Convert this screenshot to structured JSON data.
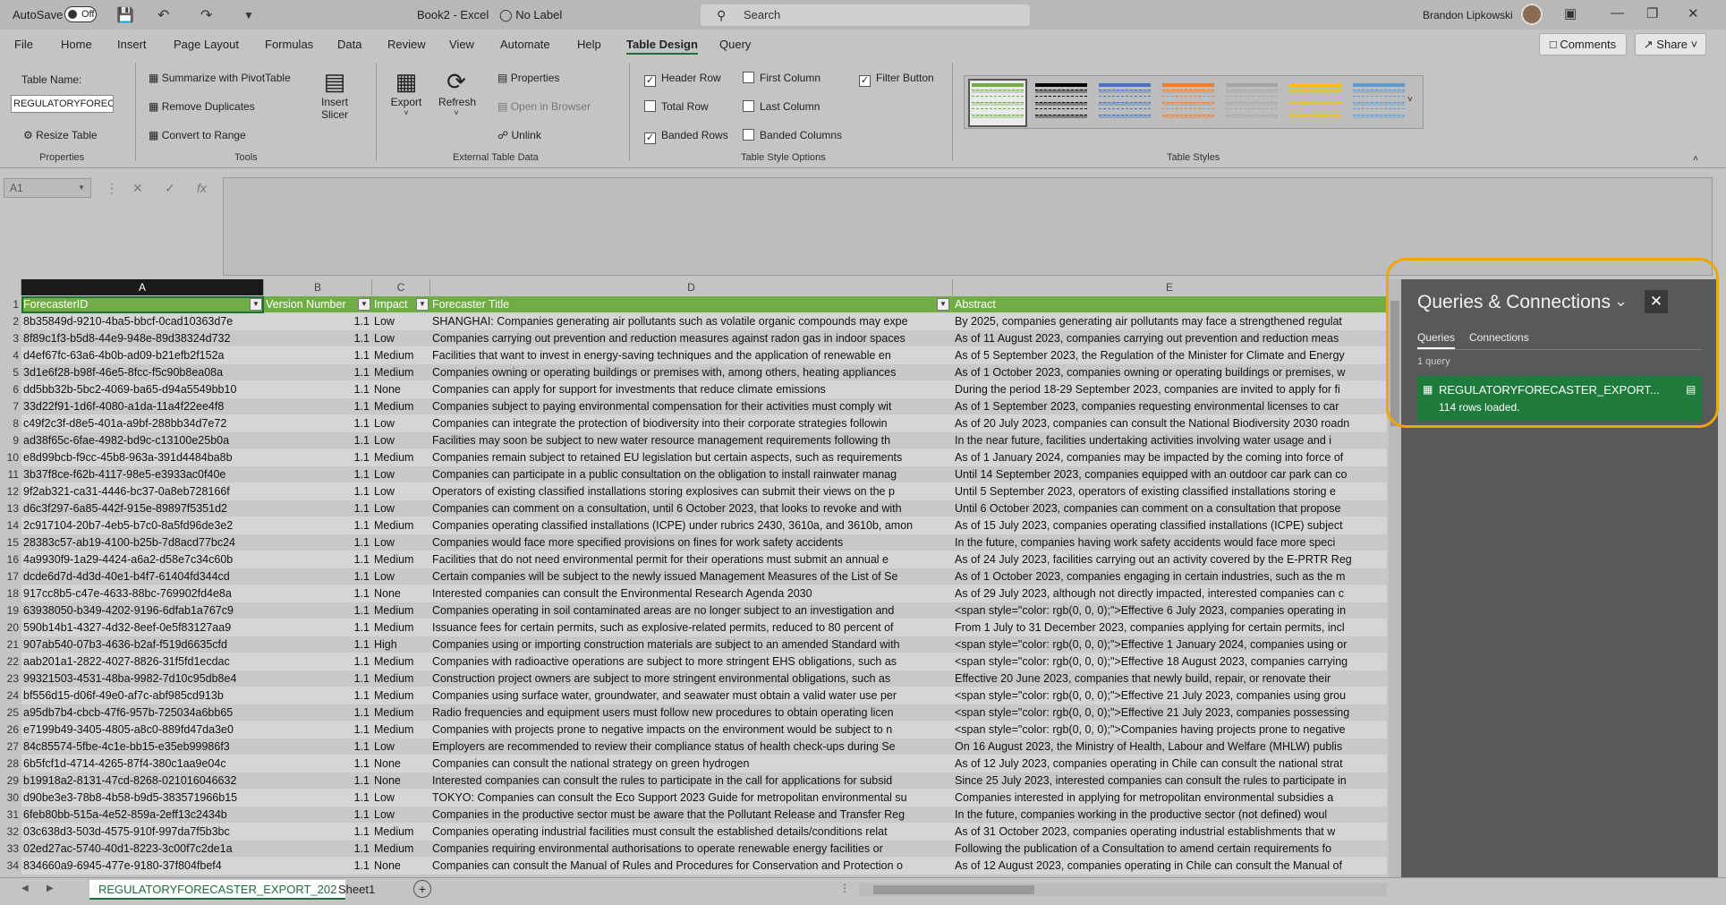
{
  "titlebar": {
    "autosave": "AutoSave",
    "toggle": "Off",
    "doc": "Book2 - Excel",
    "label": "No Label",
    "search": "Search",
    "user": "Brandon Lipkowski"
  },
  "menu": [
    "File",
    "Home",
    "Insert",
    "Page Layout",
    "Formulas",
    "Data",
    "Review",
    "View",
    "Automate",
    "Help",
    "Table Design",
    "Query"
  ],
  "menu_active": "Table Design",
  "actions": {
    "comments": "Comments",
    "share": "Share"
  },
  "ribbon": {
    "table_name_label": "Table Name:",
    "table_name": "REGULATORYFORECA",
    "resize": "Resize Table",
    "properties_group": "Properties",
    "summarize": "Summarize with PivotTable",
    "remove_dup": "Remove Duplicates",
    "convert": "Convert to Range",
    "tools_group": "Tools",
    "insert_slicer_1": "Insert",
    "insert_slicer_2": "Slicer",
    "export": "Export",
    "refresh": "Refresh",
    "properties": "Properties",
    "open_browser": "Open in Browser",
    "unlink": "Unlink",
    "external_group": "External Table Data",
    "header_row": "Header Row",
    "total_row": "Total Row",
    "banded_rows": "Banded Rows",
    "first_col": "First Column",
    "last_col": "Last Column",
    "banded_cols": "Banded Columns",
    "filter_btn": "Filter Button",
    "style_opts_group": "Table Style Options",
    "styles_group": "Table Styles",
    "checks": {
      "header_row": true,
      "total_row": false,
      "banded_rows": true,
      "first_col": false,
      "last_col": false,
      "banded_cols": false,
      "filter_btn": true
    },
    "swatch_colors": [
      "#70ad47",
      "#000000",
      "#4472c4",
      "#ed7d31",
      "#a5a5a5",
      "#ffc000",
      "#5b9bd5"
    ]
  },
  "formula": {
    "namebox": "A1"
  },
  "columns": [
    "A",
    "B",
    "C",
    "D",
    "E"
  ],
  "headers": [
    "ForecasterID",
    "Version Number",
    "Impact",
    "Forecaster Title",
    "Abstract"
  ],
  "rows": [
    [
      "8b35849d-9210-4ba5-bbcf-0cad10363d7e",
      "1.1",
      "Low",
      "SHANGHAI: Companies generating air pollutants such as volatile organic compounds may expe",
      "By 2025, companies generating air pollutants may face a strengthened regulat"
    ],
    [
      "8f89c1f3-b5d8-44e9-948e-89d38324d732",
      "1.1",
      "Low",
      "Companies carrying out prevention and reduction measures against radon gas in indoor spaces",
      "As of 11 August 2023, companies carrying out prevention and reduction meas"
    ],
    [
      "d4ef67fc-63a6-4b0b-ad09-b21efb2f152a",
      "1.1",
      "Medium",
      "Facilities that want to invest in energy-saving techniques and the application of renewable en",
      "As of 5 September 2023, the Regulation of the Minister for Climate and Energy"
    ],
    [
      "3d1e6f28-b98f-46e5-8fcc-f5c90b8ea08a",
      "1.1",
      "Medium",
      "Companies owning or operating buildings or premises with, among others, heating appliances",
      "As of 1 October 2023, companies owning or operating buildings or premises, w"
    ],
    [
      "dd5bb32b-5bc2-4069-ba65-d94a5549bb10",
      "1.1",
      "None",
      "Companies can apply for support for investments that reduce climate emissions",
      "During the period 18-29 September 2023, companies are invited to apply for fi"
    ],
    [
      "33d22f91-1d6f-4080-a1da-11a4f22ee4f8",
      "1.1",
      "Medium",
      "Companies subject to paying environmental compensation for their activities must comply wit",
      "As of 1 September 2023, companies requesting environmental licenses to car"
    ],
    [
      "c49f2c3f-d8e5-401a-a9bf-288bb34d7e72",
      "1.1",
      "Low",
      "Companies can integrate the protection of biodiversity into their corporate strategies followin",
      "As of 20 July 2023, companies can consult the National Biodiversity 2030 roadn"
    ],
    [
      "ad38f65c-6fae-4982-bd9c-c13100e25b0a",
      "1.1",
      "Low",
      "Facilities may soon be subject to new water resource management requirements following th",
      "In the near future, facilities undertaking activities involving water usage and i"
    ],
    [
      "e8d99bcb-f9cc-45b8-963a-391d4484ba8b",
      "1.1",
      "Medium",
      "Companies remain subject to retained EU legislation but certain aspects, such as requirements",
      "As of 1 January 2024, companies may be impacted by the coming into force of"
    ],
    [
      "3b37f8ce-f62b-4117-98e5-e3933ac0f40e",
      "1.1",
      "Low",
      "Companies can participate in a public consultation on the obligation to install rainwater manag",
      "Until 14 September 2023, companies equipped with an outdoor car park can co"
    ],
    [
      "9f2ab321-ca31-4446-bc37-0a8eb728166f",
      "1.1",
      "Low",
      "Operators of existing classified installations storing explosives can submit their views on the p",
      "Until 5 September 2023, operators of existing classified installations storing e"
    ],
    [
      "d6c3f297-6a85-442f-915e-89897f5351d2",
      "1.1",
      "Low",
      "Companies can comment on a consultation, until 6 October 2023, that looks to revoke and with",
      "Until 6 October 2023, companies can comment on a consultation that propose"
    ],
    [
      "2c917104-20b7-4eb5-b7c0-8a5fd96de3e2",
      "1.1",
      "Medium",
      "Companies operating classified installations (ICPE) under rubrics 2430, 3610a, and 3610b, amon",
      "As of 15 July 2023, companies operating classified installations (ICPE) subject"
    ],
    [
      "28383c57-ab19-4100-b25b-7d8acd77bc24",
      "1.1",
      "Low",
      "Companies would face more specified provisions on fines for work safety accidents",
      "In the future, companies having work safety accidents would face more speci"
    ],
    [
      "4a9930f9-1a29-4424-a6a2-d58e7c34c60b",
      "1.1",
      "Medium",
      "Facilities that do not need environmental permit for their operations must submit an annual e",
      "As of 24 July 2023, facilities carrying out an activity covered by the E-PRTR Reg"
    ],
    [
      "dcde6d7d-4d3d-40e1-b4f7-61404fd344cd",
      "1.1",
      "Low",
      "Certain companies will be subject to the newly issued Management Measures of the List of Se",
      "As of 1 October 2023, companies engaging in certain industries, such as the m"
    ],
    [
      "917cc8b5-c47e-4633-88bc-769902fd4e8a",
      "1.1",
      "None",
      "Interested companies can consult the Environmental Research Agenda 2030",
      "As of 29 July 2023, although not directly impacted, interested companies can c"
    ],
    [
      "63938050-b349-4202-9196-6dfab1a767c9",
      "1.1",
      "Medium",
      "Companies operating in soil contaminated areas are no longer subject to an investigation and",
      "<span style=\"color: rgb(0, 0, 0);\">Effective 6 July 2023, companies operating in"
    ],
    [
      "590b14b1-4327-4d32-8eef-0e5f83127aa9",
      "1.1",
      "Medium",
      "Issuance fees for certain permits, such as explosive-related permits, reduced to 80 percent of",
      "From 1 July to 31 December 2023, companies applying for certain permits, incl"
    ],
    [
      "907ab540-07b3-4636-b2af-f519d6635cfd",
      "1.1",
      "High",
      "Companies using or importing construction materials are subject to an amended Standard with",
      "<span style=\"color: rgb(0, 0, 0);\">Effective 1 January 2024, companies using or"
    ],
    [
      "aab201a1-2822-4027-8826-31f5fd1ecdac",
      "1.1",
      "Medium",
      "Companies with radioactive operations are subject to more stringent EHS obligations, such as",
      "<span style=\"color: rgb(0, 0, 0);\">Effective 18 August 2023, companies carrying"
    ],
    [
      "99321503-4531-48ba-9982-7d10c95db8e4",
      "1.1",
      "Medium",
      "Construction project owners are subject to more stringent environmental obligations, such as",
      "Effective 20 June 2023, companies that newly build, repair, or renovate their"
    ],
    [
      "bf556d15-d06f-49e0-af7c-abf985cd913b",
      "1.1",
      "Medium",
      "Companies using surface water, groundwater, and seawater must obtain a valid water use per",
      "<span style=\"color: rgb(0, 0, 0);\">Effective 21 July 2023, companies using grou"
    ],
    [
      "a95db7b4-cbcb-47f6-957b-725034a6bb65",
      "1.1",
      "Medium",
      "Radio frequencies and equipment users must follow new procedures to obtain operating licen",
      "<span style=\"color: rgb(0, 0, 0);\">Effective 21 July 2023, companies possessing"
    ],
    [
      "e7199b49-3405-4805-a8c0-889fd47da3e0",
      "1.1",
      "Medium",
      "Companies with projects prone to negative impacts on the environment would be subject to n",
      "<span style=\"color: rgb(0, 0, 0);\">Companies having projects prone to negative"
    ],
    [
      "84c85574-5fbe-4c1e-bb15-e35eb99986f3",
      "1.1",
      "Low",
      "Employers are recommended to review their compliance status of health check-ups during Se",
      "On 16 August 2023, the Ministry of Health, Labour and Welfare (MHLW) publis"
    ],
    [
      "6b5fcf1d-4714-4265-87f4-380c1aa9e04c",
      "1.1",
      "None",
      "Companies can consult the national strategy on green hydrogen",
      "As of 12 July 2023, companies operating in Chile can consult the national strat"
    ],
    [
      "b19918a2-8131-47cd-8268-021016046632",
      "1.1",
      "None",
      " Interested companies can consult the rules to participate in the call for applications for subsid",
      "Since 25 July 2023, interested companies can consult the rules to participate in"
    ],
    [
      "d90be3e3-78b8-4b58-b9d5-383571966b15",
      "1.1",
      "Low",
      "TOKYO: Companies can consult the Eco Support 2023 Guide for metropolitan environmental su",
      "Companies interested in applying for metropolitan environmental subsidies a"
    ],
    [
      "6feb80bb-515a-4e52-859a-2eff13c2434b",
      "1.1",
      "Low",
      "Companies in the productive sector must be aware that the Pollutant Release and Transfer Reg",
      "In the future, companies working in the productive sector (not defined) woul"
    ],
    [
      "03c638d3-503d-4575-910f-997da7f5b3bc",
      "1.1",
      "Medium",
      "Companies operating industrial facilities must consult the established details/conditions relat",
      "As of 31 October 2023, companies operating industrial establishments that w"
    ],
    [
      "02ed27ac-5740-40d1-8223-3c00f7c2de1a",
      "1.1",
      "Medium",
      "Companies requiring environmental authorisations to operate renewable energy facilities or",
      "Following the publication of a Consultation to amend certain requirements fo"
    ],
    [
      "834660a9-6945-477e-9180-37f804fbef4",
      "1.1",
      "None",
      "Companies can consult the Manual of Rules and Procedures for Conservation and Protection o",
      "As of 12 August 2023, companies operating in Chile can consult the Manual of"
    ]
  ],
  "sheets": [
    "REGULATORYFORECASTER_EXPORT_202",
    "Sheet1"
  ],
  "queries": {
    "title": "Queries & Connections",
    "tab_queries": "Queries",
    "tab_connections": "Connections",
    "count": "1 query",
    "item_name": "REGULATORYFORECASTER_EXPORT...",
    "item_status": "114 rows loaded."
  }
}
